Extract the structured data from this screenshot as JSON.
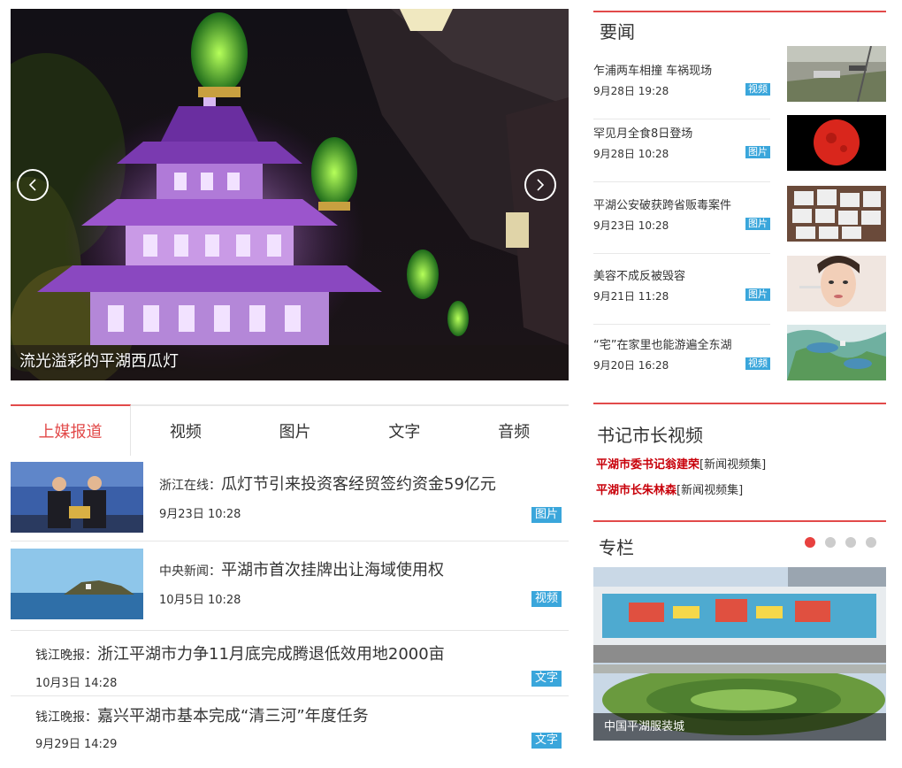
{
  "hero": {
    "caption": "流光溢彩的平湖西瓜灯",
    "prev_icon": "chevron-left-icon",
    "next_icon": "chevron-right-icon"
  },
  "tabs": [
    {
      "label": "上媒报道",
      "active": true
    },
    {
      "label": "视频",
      "active": false
    },
    {
      "label": "图片",
      "active": false
    },
    {
      "label": "文字",
      "active": false
    },
    {
      "label": "音频",
      "active": false
    }
  ],
  "news": [
    {
      "source": "浙江在线：",
      "title": "瓜灯节引来投资客经贸签约资金59亿元",
      "time": "9月23日  10:28",
      "badge": "图片",
      "has_thumb": true
    },
    {
      "source": "中央新闻：",
      "title": "平湖市首次挂牌出让海域使用权",
      "time": "10月5日  10:28",
      "badge": "视频",
      "has_thumb": true
    },
    {
      "source": "钱江晚报：",
      "title": "浙江平湖市力争11月底完成腾退低效用地2000亩",
      "time": "10月3日  14:28",
      "badge": "文字",
      "has_thumb": false
    },
    {
      "source": "钱江晚报：",
      "title": "嘉兴平湖市基本完成“清三河”年度任务",
      "time": "9月29日  14:29",
      "badge": "文字",
      "has_thumb": false
    }
  ],
  "yaowen": {
    "title": "要闻",
    "items": [
      {
        "title": "乍浦两车相撞 车祸现场",
        "time": "9月28日  19:28",
        "badge": "视频"
      },
      {
        "title": "罕见月全食8日登场",
        "time": "9月28日  10:28",
        "badge": "图片"
      },
      {
        "title": "平湖公安破获跨省贩毒案件",
        "time": "9月23日  10:28",
        "badge": "图片"
      },
      {
        "title": "美容不成反被毁容",
        "time": "9月21日  11:28",
        "badge": "图片"
      },
      {
        "title": "“宅”在家里也能游遍全东湖",
        "time": "9月20日  16:28",
        "badge": "视频"
      }
    ]
  },
  "shuji": {
    "title": "书记市长视频",
    "links": [
      {
        "red": "平湖市委书记翁建荣",
        "black": "[新闻视频集]"
      },
      {
        "red": "平湖市长朱林森",
        "black": "[新闻视频集]"
      }
    ]
  },
  "zhuanlan": {
    "title": "专栏",
    "caption": "中国平湖服装城",
    "dots": 4,
    "active_dot": 0
  },
  "colors": {
    "accent_red": "#e24a4a",
    "badge_blue": "#3aa6db",
    "link_red": "#c8000a"
  }
}
